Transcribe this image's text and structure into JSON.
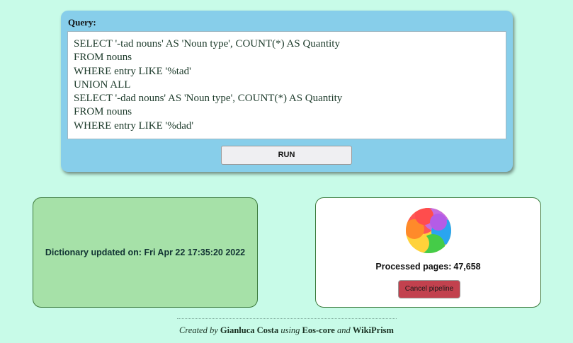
{
  "query": {
    "label": "Query:",
    "text": "SELECT '-tad nouns' AS 'Noun type', COUNT(*) AS Quantity\nFROM nouns\nWHERE entry LIKE '%tad'\nUNION ALL\nSELECT '-dad nouns' AS 'Noun type', COUNT(*) AS Quantity\nFROM nouns\nWHERE entry LIKE '%dad'",
    "run_label": "RUN"
  },
  "dictionary": {
    "updated_text": "Dictionary updated on: Fri Apr 22 17:35:20 2022"
  },
  "pipeline": {
    "spinner_icon": "spinner-icon",
    "processed_label": "Processed pages:",
    "processed_count": "47,658",
    "cancel_label": "Cancel pipeline"
  },
  "footer": {
    "created_by": "Created by",
    "author": "Gianluca Costa",
    "using": "using",
    "tool": "Eos-core",
    "and": "and",
    "project": "WikiPrism"
  },
  "colors": {
    "background": "#c8fbe8",
    "query_panel": "#87ceea",
    "dictionary_card": "#a6e1a8",
    "cancel_button": "#c2414e",
    "card_border": "#3c7a3c"
  }
}
